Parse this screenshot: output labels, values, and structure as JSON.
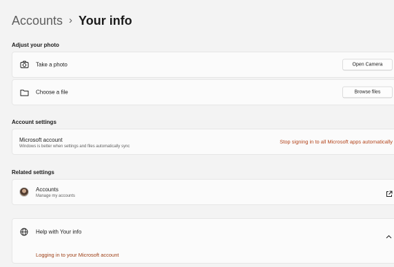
{
  "breadcrumb": {
    "parent": "Accounts",
    "separator": "›",
    "current": "Your info"
  },
  "sections": {
    "photo": "Adjust your photo",
    "account": "Account settings",
    "related": "Related settings"
  },
  "photo_rows": {
    "take_photo_label": "Take a photo",
    "take_photo_button": "Open Camera",
    "choose_file_label": "Choose a file",
    "choose_file_button": "Browse files"
  },
  "account_row": {
    "title": "Microsoft account",
    "description": "Windows is better when settings and files automatically sync",
    "action": "Stop signing in to all Microsoft apps automatically"
  },
  "related_row": {
    "title": "Accounts",
    "description": "Manage my accounts"
  },
  "help": {
    "title": "Help with Your info",
    "link": "Logging in to your Microsoft account"
  },
  "icons": {
    "take_photo": "camera-icon",
    "choose_file": "folder-icon",
    "accounts": "avatar",
    "external": "open-external-icon",
    "help": "globe-icon",
    "collapse": "chevron-up-icon"
  },
  "colors": {
    "background": "#f3f3f3",
    "card": "#fbfbfb",
    "accent": "#b13f15"
  }
}
